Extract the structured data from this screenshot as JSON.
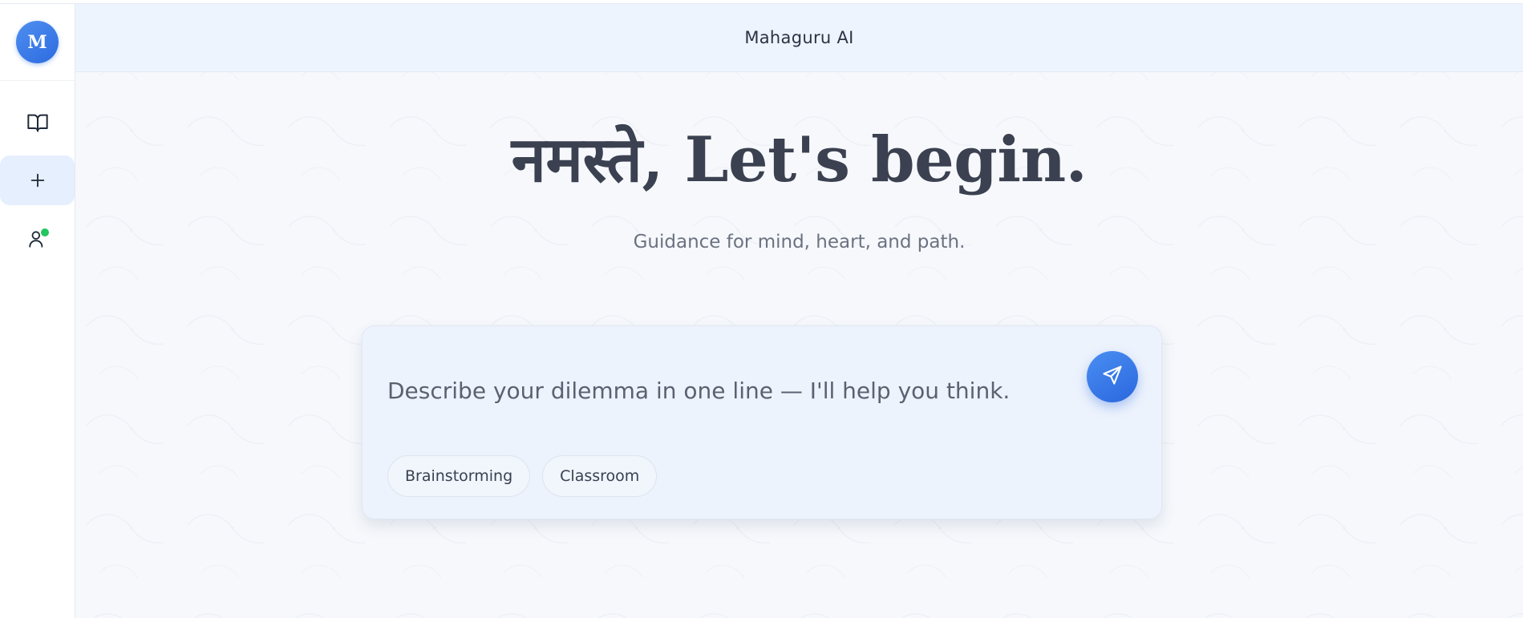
{
  "app": {
    "logo_letter": "M",
    "title": "Mahaguru AI"
  },
  "sidebar": {
    "items": [
      {
        "name": "library",
        "icon": "open-book-icon"
      },
      {
        "name": "new-chat",
        "icon": "plus-icon",
        "active": true
      },
      {
        "name": "profile",
        "icon": "user-icon",
        "status": "online"
      }
    ],
    "status_color": "#22c55e"
  },
  "hero": {
    "greeting": "नमस्ते, Let's begin.",
    "subtitle": "Guidance for mind, heart, and path."
  },
  "composer": {
    "placeholder": "Describe your dilemma in one line — I'll help you think.",
    "value": "",
    "send_icon": "paper-plane-icon",
    "chips": [
      "Brainstorming",
      "Classroom"
    ]
  },
  "colors": {
    "accent": "#2f6fe2",
    "background": "#f6f8fc",
    "header": "#eef4fe",
    "text": "#3b4150"
  }
}
